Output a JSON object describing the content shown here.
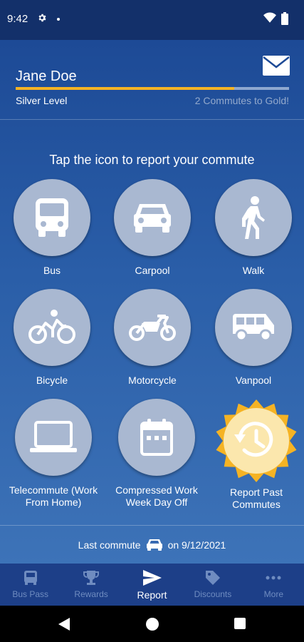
{
  "status_bar": {
    "time": "9:42",
    "icons": [
      "gear-icon",
      "notification-dot",
      "wifi-icon",
      "battery-icon"
    ]
  },
  "profile": {
    "name": "Jane Doe",
    "level": "Silver Level",
    "goal": "2 Commutes to Gold!",
    "progress_fraction": 0.8,
    "icon": "mail-icon"
  },
  "prompt": "Tap the icon to report your commute",
  "modes": [
    {
      "label": "Bus",
      "icon": "bus-icon"
    },
    {
      "label": "Carpool",
      "icon": "car-icon"
    },
    {
      "label": "Walk",
      "icon": "walk-icon"
    },
    {
      "label": "Bicycle",
      "icon": "bicycle-icon"
    },
    {
      "label": "Motorcycle",
      "icon": "motorcycle-icon"
    },
    {
      "label": "Vanpool",
      "icon": "van-icon"
    },
    {
      "label": "Telecommute (Work From Home)",
      "icon": "laptop-icon"
    },
    {
      "label": "Compressed Work Week Day Off",
      "icon": "calendar-icon"
    }
  ],
  "report_past": {
    "label": "Report Past Commutes",
    "icon": "history-icon"
  },
  "last_commute": {
    "prefix": "Last commute",
    "date_text": "on 9/12/2021",
    "icon": "car-icon"
  },
  "bottom_nav": [
    {
      "label": "Bus Pass",
      "icon": "bus-icon",
      "active": false
    },
    {
      "label": "Rewards",
      "icon": "trophy-icon",
      "active": false
    },
    {
      "label": "Report",
      "icon": "send-icon",
      "active": true
    },
    {
      "label": "Discounts",
      "icon": "tag-icon",
      "active": false
    },
    {
      "label": "More",
      "icon": "more-icon",
      "active": false
    }
  ],
  "colors": {
    "status_bar": "#13306a",
    "accent_gold": "#f5b324",
    "circle": "#a9b8d1",
    "nav_bg": "#1d3f88",
    "nav_inactive": "#6f8cc0"
  }
}
